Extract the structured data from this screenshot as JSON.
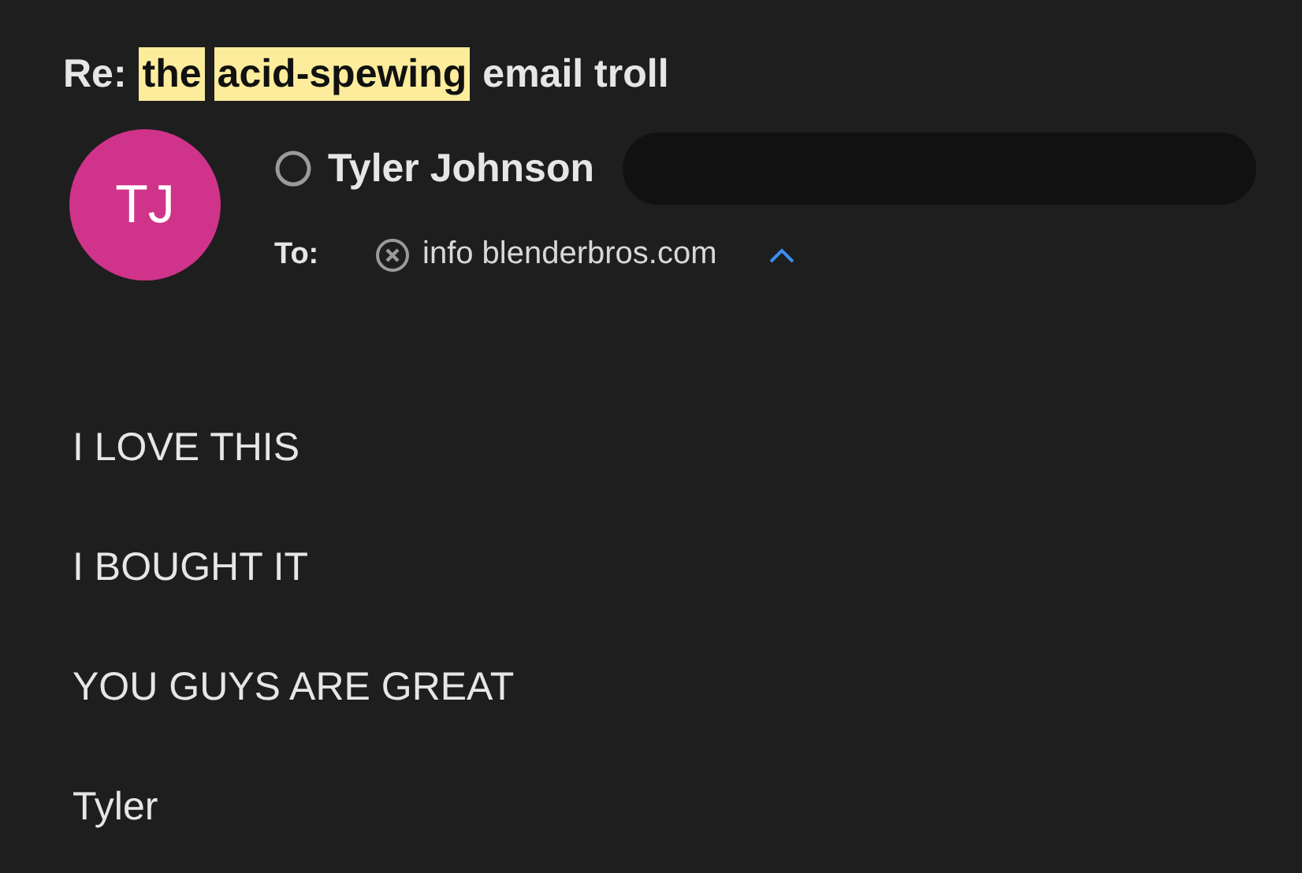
{
  "subject": [
    {
      "text": "Re:",
      "highlighted": false
    },
    {
      "text": "the",
      "highlighted": true
    },
    {
      "text": "acid-spewing",
      "highlighted": true
    },
    {
      "text": "email troll",
      "highlighted": false
    }
  ],
  "sender": {
    "initials": "TJ",
    "name": "Tyler Johnson",
    "online": false
  },
  "recipients": {
    "label": "To:",
    "items": [
      {
        "name": "info blenderbros.com"
      }
    ],
    "expanded": true
  },
  "body": [
    "I LOVE THIS",
    "I BOUGHT IT",
    "YOU GUYS ARE GREAT",
    "Tyler"
  ]
}
